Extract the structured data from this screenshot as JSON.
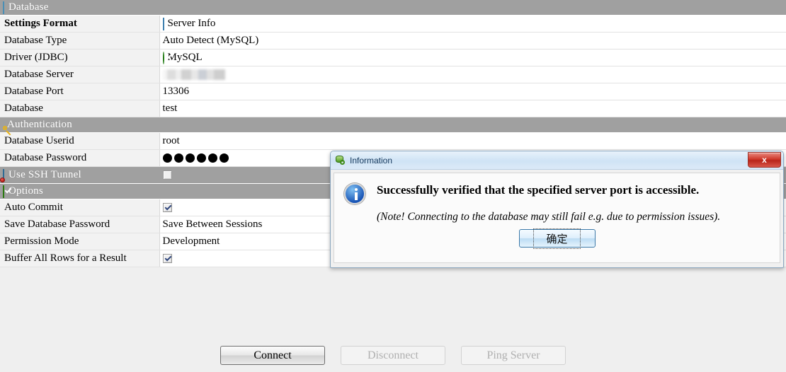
{
  "sections": [
    {
      "type": "section",
      "name": "database",
      "icon": "database-cylinder-icon",
      "label": "Database"
    },
    {
      "type": "prop",
      "name": "settings-format",
      "label": "Settings Format",
      "bold": true,
      "value": "Server Info",
      "icon": "server-info-form-icon"
    },
    {
      "type": "prop",
      "name": "database-type",
      "label": "Database Type",
      "value": "Auto Detect (MySQL)"
    },
    {
      "type": "prop",
      "name": "driver-jdbc",
      "label": "Driver (JDBC)",
      "value": "MySQL",
      "icon": "green-check-circle-icon"
    },
    {
      "type": "prop",
      "name": "database-server",
      "label": "Database Server",
      "value": "",
      "redacted": true
    },
    {
      "type": "prop",
      "name": "database-port",
      "label": "Database Port",
      "value": "13306"
    },
    {
      "type": "prop",
      "name": "database-name",
      "label": "Database",
      "value": "test"
    },
    {
      "type": "section",
      "name": "authentication",
      "icon": "key-icon",
      "label": "Authentication"
    },
    {
      "type": "prop",
      "name": "database-userid",
      "label": "Database Userid",
      "value": "root"
    },
    {
      "type": "prop",
      "name": "database-password",
      "label": "Database Password",
      "value": "······",
      "password_dots": 6
    },
    {
      "type": "ssh",
      "name": "use-ssh-tunnel",
      "icon": "ssh-server-icon",
      "label": "Use SSH Tunnel",
      "checked": false
    },
    {
      "type": "section",
      "name": "options",
      "icon": "green-check-square-icon",
      "label": "Options"
    },
    {
      "type": "prop",
      "name": "auto-commit",
      "label": "Auto Commit",
      "checkbox": true,
      "checked": true
    },
    {
      "type": "prop",
      "name": "save-database-password",
      "label": "Save Database Password",
      "value": "Save Between Sessions"
    },
    {
      "type": "prop",
      "name": "permission-mode",
      "label": "Permission Mode",
      "value": "Development"
    },
    {
      "type": "prop",
      "name": "buffer-all-rows",
      "label": "Buffer All Rows for a Result",
      "checkbox": true,
      "checked": true
    }
  ],
  "buttons": {
    "connect": "Connect",
    "disconnect": "Disconnect",
    "ping_server": "Ping Server"
  },
  "dialog": {
    "title": "Information",
    "title_icon": "database-search-icon",
    "close_label": "x",
    "info_icon": "info-icon",
    "message": "Successfully verified that the specified server port is accessible.",
    "note": "(Note! Connecting to the database may still fail e.g. due to permission issues).",
    "ok_label": "确定"
  },
  "colors": {
    "section_header_bg": "#a0a0a0",
    "label_column_bg": "#f2f2f2",
    "page_bg": "#efefef",
    "accent_green": "#3da019",
    "accent_blue": "#1753b5",
    "close_red": "#cf3a2c"
  }
}
